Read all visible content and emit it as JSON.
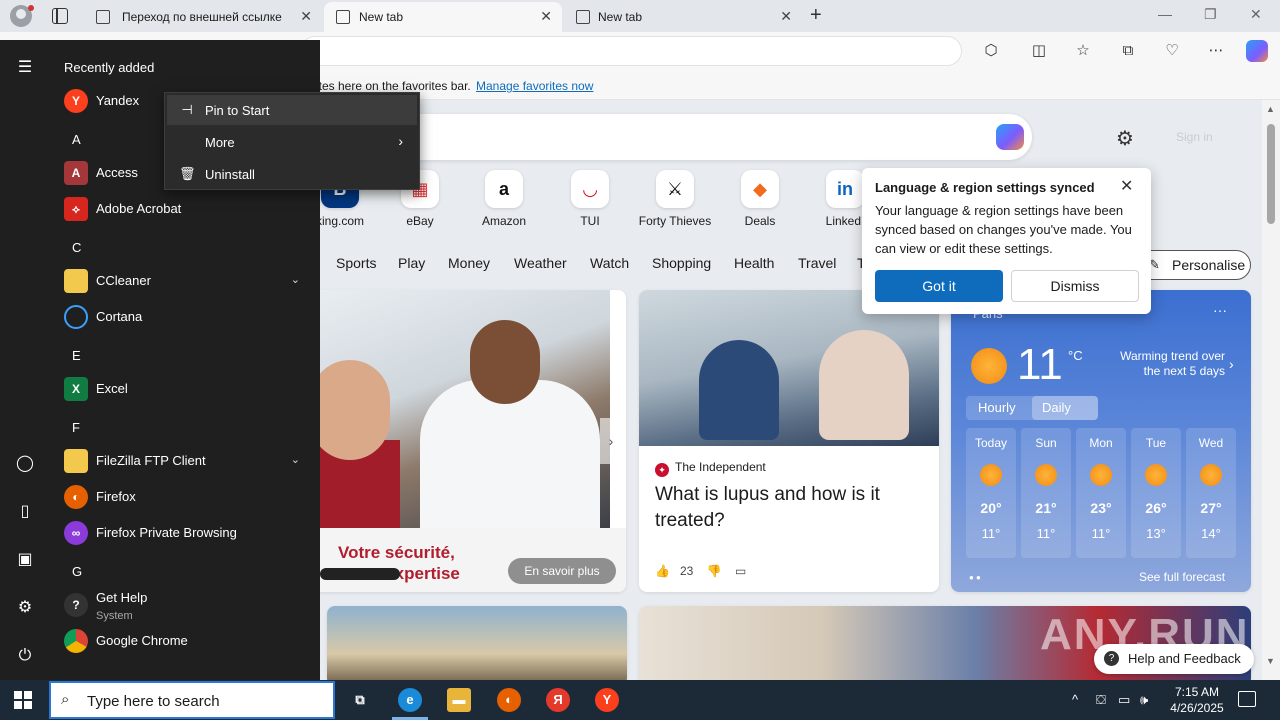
{
  "browser": {
    "tabs": [
      {
        "title": "Переход по внешней ссылке",
        "active": false
      },
      {
        "title": "New tab",
        "active": true
      },
      {
        "title": "New tab",
        "active": false
      }
    ],
    "new_tab_glyph": "+",
    "close_glyph": "✕",
    "window_controls": {
      "minimize": "—",
      "maximize": "❐",
      "close": "✕"
    },
    "favorites_bar": {
      "text": "ites here on the favorites bar.",
      "link": "Manage favorites now"
    },
    "toolbar_icons": [
      "extensions-icon",
      "split-screen-icon",
      "favorites-icon",
      "collections-icon",
      "browser-essentials-icon",
      "more-icon",
      "copilot-icon"
    ]
  },
  "newtab": {
    "signin": "Sign in",
    "quicklinks": [
      {
        "label": "king.com",
        "glyph": "B",
        "color": "#003580"
      },
      {
        "label": "eBay",
        "glyph": "▦",
        "color": "#e53238"
      },
      {
        "label": "Amazon",
        "glyph": "a",
        "color": "#111111"
      },
      {
        "label": "TUI",
        "glyph": "◡",
        "color": "#d40e14"
      },
      {
        "label": "Forty Thieves",
        "glyph": "⚔",
        "color": "#111111"
      },
      {
        "label": "Deals",
        "glyph": "◆",
        "color": "#f26b1d"
      },
      {
        "label": "LinkedI",
        "glyph": "in",
        "color": "#0a66c2"
      }
    ],
    "categories": [
      "Sports",
      "Play",
      "Money",
      "Weather",
      "Watch",
      "Shopping",
      "Health",
      "Travel",
      "T"
    ],
    "personalise": "Personalise",
    "ad": {
      "slogan_line1": "Votre sécurité,",
      "slogan_line2": "notre expertise",
      "cta": "En savoir plus"
    },
    "news": {
      "source": "The Independent",
      "source_glyph": "✦",
      "headline": "What is lupus and how is it treated?",
      "likes": "23"
    },
    "weather": {
      "location": "Paris",
      "temperature": "11",
      "unit": "°C",
      "trend": "Warming trend over the next 5 days",
      "toggle": [
        "Hourly",
        "Daily"
      ],
      "selected": "Daily",
      "days": [
        {
          "name": "Today",
          "hi": "20°",
          "lo": "11°"
        },
        {
          "name": "Sun",
          "hi": "21°",
          "lo": "11°"
        },
        {
          "name": "Mon",
          "hi": "23°",
          "lo": "11°"
        },
        {
          "name": "Tue",
          "hi": "26°",
          "lo": "13°"
        },
        {
          "name": "Wed",
          "hi": "27°",
          "lo": "14°"
        }
      ],
      "forecast_link": "See full forecast",
      "more_glyph": "···"
    },
    "popup": {
      "title": "Language & region settings synced",
      "body": "Your language & region settings have been synced based on changes you've made. You can view or edit these settings.",
      "primary": "Got it",
      "secondary": "Dismiss"
    },
    "feedback": "Help and Feedback",
    "watermark": "ANY.RUN"
  },
  "start_menu": {
    "header": "Recently added",
    "items": [
      {
        "type": "app",
        "name": "Yandex",
        "icon": "yandex-icon",
        "color": "#fc3f1d",
        "glyph": "Y"
      },
      {
        "type": "letter",
        "name": "A"
      },
      {
        "type": "app",
        "name": "Access",
        "icon": "access-icon",
        "color": "#a4373a",
        "glyph": "A"
      },
      {
        "type": "app",
        "name": "Adobe Acrobat",
        "icon": "acrobat-icon",
        "color": "#d7261e",
        "glyph": "⟡"
      },
      {
        "type": "letter",
        "name": "C"
      },
      {
        "type": "folder",
        "name": "CCleaner",
        "icon": "folder-icon",
        "color": "#f2c94c",
        "glyph": ""
      },
      {
        "type": "app",
        "name": "Cortana",
        "icon": "cortana-icon",
        "color": "#1f1f1f",
        "glyph": "○"
      },
      {
        "type": "letter",
        "name": "E"
      },
      {
        "type": "app",
        "name": "Excel",
        "icon": "excel-icon",
        "color": "#107c41",
        "glyph": "X"
      },
      {
        "type": "letter",
        "name": "F"
      },
      {
        "type": "folder",
        "name": "FileZilla FTP Client",
        "icon": "folder-icon",
        "color": "#f2c94c",
        "glyph": ""
      },
      {
        "type": "app",
        "name": "Firefox",
        "icon": "firefox-icon",
        "color": "#e66000",
        "glyph": "◐"
      },
      {
        "type": "app",
        "name": "Firefox Private Browsing",
        "icon": "firefox-private-icon",
        "color": "#8a3bd9",
        "glyph": "∞"
      },
      {
        "type": "letter",
        "name": "G"
      },
      {
        "type": "app",
        "name": "Get Help",
        "sub": "System",
        "icon": "get-help-icon",
        "color": "#1f1f1f",
        "glyph": "?"
      },
      {
        "type": "app",
        "name": "Google Chrome",
        "icon": "chrome-icon",
        "color": "#2c9b46",
        "glyph": "◉"
      }
    ],
    "context_menu": [
      {
        "label": "Pin to Start",
        "icon": "pin-icon",
        "glyph": "⊣"
      },
      {
        "label": "More",
        "icon": "",
        "glyph": "",
        "arrow": "›"
      },
      {
        "label": "Uninstall",
        "icon": "trash-icon",
        "glyph": "🗑"
      }
    ]
  },
  "taskbar": {
    "search_placeholder": "Type here to search",
    "apps": [
      {
        "name": "task-view",
        "glyph": "⧉",
        "color": "transparent"
      },
      {
        "name": "edge",
        "glyph": "e",
        "color": "#1b8ad8"
      },
      {
        "name": "file-explorer",
        "glyph": "▬",
        "color": "#e8b43a"
      },
      {
        "name": "firefox",
        "glyph": "◐",
        "color": "#e66000"
      },
      {
        "name": "yandex-browser",
        "glyph": "Я",
        "color": "#e53a2b"
      },
      {
        "name": "yandex",
        "glyph": "Y",
        "color": "#fc3f1d"
      }
    ],
    "tray": [
      "^",
      "⛋",
      "▭",
      "🕪"
    ],
    "time": "7:15 AM",
    "date": "4/26/2025"
  },
  "colors": {
    "accent": "#0f6cbd",
    "start_bg": "#1f1f1f",
    "taskbar_bg": "#1c2a38"
  }
}
